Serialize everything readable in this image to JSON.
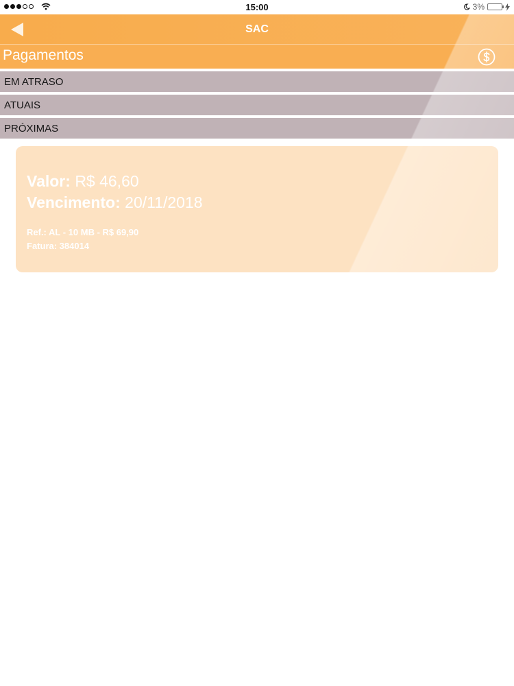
{
  "status_bar": {
    "time": "15:00",
    "battery_percent": "3%",
    "signal_bars_filled": 3,
    "signal_bars_total": 5,
    "icons": [
      "signal-icon",
      "wifi-icon",
      "moon-icon",
      "battery-icon",
      "charging-icon"
    ]
  },
  "nav": {
    "title": "SAC",
    "back_icon": "back-arrow-icon"
  },
  "section": {
    "title": "Pagamentos",
    "icon": "dollar-circle-icon"
  },
  "tabs": [
    {
      "label": "EM ATRASO"
    },
    {
      "label": "ATUAIS"
    },
    {
      "label": "PRÓXIMAS"
    }
  ],
  "payment": {
    "valor_label": "Valor:",
    "valor_value": "R$ 46,60",
    "vencimento_label": "Vencimento:",
    "vencimento_value": "20/11/2018",
    "ref": "Ref.: AL - 10 MB - R$ 69,90",
    "fatura": "Fatura: 384014"
  },
  "colors": {
    "accent": "#f8ac4c",
    "tab_background": "#c0b2b6",
    "card_background": "#fde2c2"
  }
}
